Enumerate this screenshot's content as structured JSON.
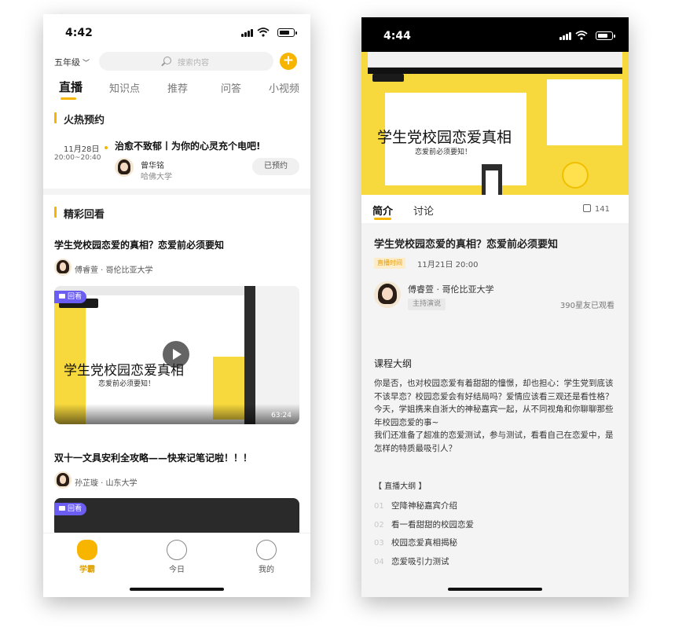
{
  "left": {
    "status_time": "4:42",
    "grade": "五年级",
    "search_placeholder": "搜索内容",
    "plus": "+",
    "tabs": [
      "直播",
      "知识点",
      "推荐",
      "问答",
      "小视频"
    ],
    "hot_section_title": "火热预约",
    "live": {
      "date": "11月28日",
      "time_range": "20:00~20:40",
      "title": "治愈不致郁丨为你的心灵充个电吧!",
      "teacher": "曾华铭",
      "school": "哈佛大学",
      "booked_label": "已预约"
    },
    "replay_section_title": "精彩回看",
    "videos": [
      {
        "title": "学生党校园恋爱的真相？恋爱前必须要知",
        "author": "傅睿萱 · 哥伦比亚大学",
        "badge": "回看",
        "screen_big_text": "学生党校园恋爱真相",
        "screen_sub_text": "恋爱前必须要知！",
        "duration": "63:24"
      },
      {
        "title": "双十一文具安利全攻略——快来记笔记啦！！！",
        "author": "孙芷璇 · 山东大学",
        "badge": "回看"
      }
    ],
    "nav": [
      {
        "label": "学霸",
        "icon": "thumbs-up-mascot-icon",
        "active": true
      },
      {
        "label": "今日",
        "icon": "baby-face-icon",
        "active": false
      },
      {
        "label": "我的",
        "icon": "smiley-face-icon",
        "active": false
      }
    ],
    "accent": "#f7b500"
  },
  "right": {
    "status_time": "4:44",
    "video": {
      "big_text": "学生党校园恋爱真相",
      "sub_text": "恋爱前必须要知！"
    },
    "tabs": [
      "简介",
      "讨论"
    ],
    "like_count": "141",
    "title": "学生党校园恋爱的真相？恋爱前必须要知",
    "tag": "直播时间",
    "date": "11月21日 20:00",
    "author": "傅睿萱 · 哥伦比亚大学",
    "role": "主持演说",
    "watched": "390星友已观看",
    "outline_heading": "课程大纲",
    "description": [
      "你是否，也对校园恋爱有着甜甜的憧憬，却也担心：学生党到底该不该早恋？校园恋爱会有好结局吗？爱情应该看三观还是看性格？",
      "今天，学姐携来自浙大的神秘嘉宾一起，从不同视角和你聊聊那些年校园恋爱的事~",
      "我们还准备了超准的恋爱测试，参与测试，看看自己在恋爱中，是怎样的特质最吸引人？"
    ],
    "outline_tag": "【 直播大纲 】",
    "outline": [
      {
        "num": "01",
        "text": "空降神秘嘉宾介绍"
      },
      {
        "num": "02",
        "text": "看一看甜甜的校园恋爱"
      },
      {
        "num": "03",
        "text": "校园恋爱真相揭秘"
      },
      {
        "num": "04",
        "text": "恋爱吸引力测试"
      }
    ]
  }
}
